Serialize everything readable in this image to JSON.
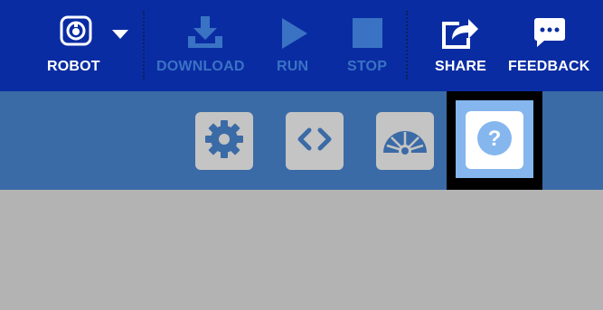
{
  "toolbar": {
    "robot_label": "ROBOT",
    "download_label": "DOWNLOAD",
    "run_label": "RUN",
    "stop_label": "STOP",
    "share_label": "SHARE",
    "feedback_label": "FEEDBACK"
  },
  "icons": {
    "robot": "robot-icon",
    "dropdown": "caret-down-icon",
    "download": "download-icon",
    "run": "play-icon",
    "stop": "stop-icon",
    "share": "share-icon",
    "feedback": "chat-bubble-icon",
    "settings": "gear-icon",
    "code": "code-icon",
    "dashboard": "gauge-icon",
    "help": "question-icon"
  },
  "colors": {
    "toolbar_bg": "#0a2ca3",
    "subbar_bg": "#3b6ba6",
    "disabled_text": "#3a73c4",
    "help_highlight": "#85b6ee",
    "content_bg": "#b3b3b3"
  },
  "help": {
    "glyph": "?"
  }
}
